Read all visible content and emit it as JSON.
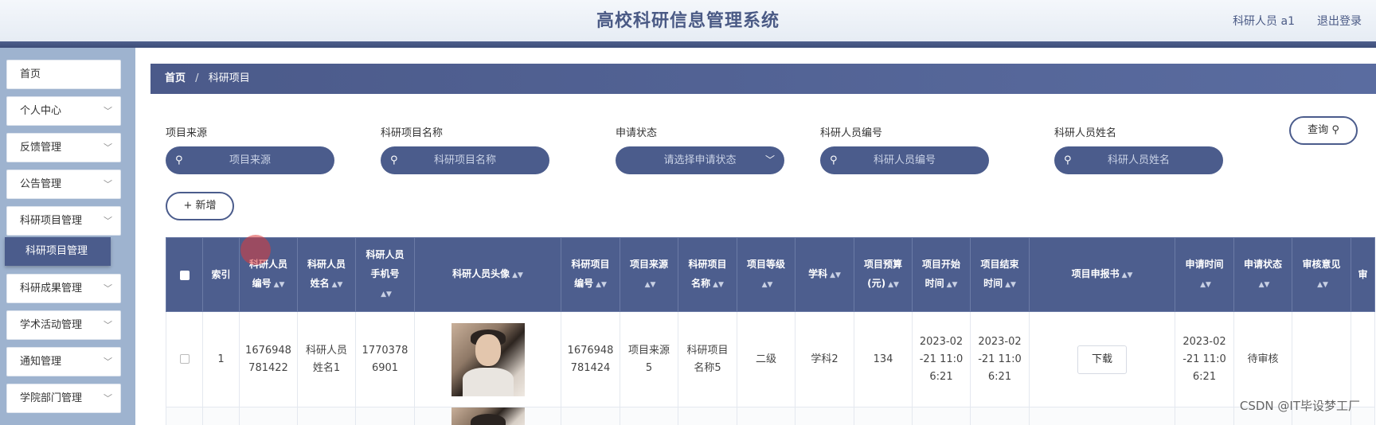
{
  "header": {
    "title": "高校科研信息管理系统",
    "user": "科研人员 a1",
    "logout": "退出登录"
  },
  "sidebar": {
    "items": [
      {
        "label": "首页",
        "has_chevron": false
      },
      {
        "label": "个人中心",
        "has_chevron": true
      },
      {
        "label": "反馈管理",
        "has_chevron": true
      },
      {
        "label": "公告管理",
        "has_chevron": true
      },
      {
        "label": "科研项目管理",
        "has_chevron": true
      },
      {
        "label": "科研成果管理",
        "has_chevron": true
      },
      {
        "label": "学术活动管理",
        "has_chevron": true
      },
      {
        "label": "通知管理",
        "has_chevron": true
      },
      {
        "label": "学院部门管理",
        "has_chevron": true
      }
    ],
    "active_sub": "科研项目管理",
    "chevron_glyph": "﹀"
  },
  "breadcrumb": {
    "home": "首页",
    "sep": "/",
    "current": "科研项目"
  },
  "filters": [
    {
      "label": "项目来源",
      "placeholder": "项目来源",
      "type": "text"
    },
    {
      "label": "科研项目名称",
      "placeholder": "科研项目名称",
      "type": "text"
    },
    {
      "label": "申请状态",
      "placeholder": "请选择申请状态",
      "type": "select"
    },
    {
      "label": "科研人员编号",
      "placeholder": "科研人员编号",
      "type": "text"
    },
    {
      "label": "科研人员姓名",
      "placeholder": "科研人员姓名",
      "type": "text"
    }
  ],
  "buttons": {
    "query": "查询",
    "add": "新增"
  },
  "table": {
    "columns": [
      {
        "l1": "",
        "l2": "",
        "sortable": false
      },
      {
        "l1": "索引",
        "l2": "",
        "sortable": false
      },
      {
        "l1": "科研人员",
        "l2": "编号",
        "sortable": true
      },
      {
        "l1": "科研人员",
        "l2": "姓名",
        "sortable": true
      },
      {
        "l1": "科研人员",
        "l2": "手机号",
        "sortable": true
      },
      {
        "l1": "科研人员头像",
        "l2": "",
        "sortable": true
      },
      {
        "l1": "科研项目",
        "l2": "编号",
        "sortable": true
      },
      {
        "l1": "项目来源",
        "l2": "",
        "sortable": true
      },
      {
        "l1": "科研项目",
        "l2": "名称",
        "sortable": true
      },
      {
        "l1": "项目等级",
        "l2": "",
        "sortable": true
      },
      {
        "l1": "学科",
        "l2": "",
        "sortable": true
      },
      {
        "l1": "项目预算",
        "l2": "(元)",
        "sortable": true
      },
      {
        "l1": "项目开始",
        "l2": "时间",
        "sortable": true
      },
      {
        "l1": "项目结束",
        "l2": "时间",
        "sortable": true
      },
      {
        "l1": "项目申报书",
        "l2": "",
        "sortable": true
      },
      {
        "l1": "申请时间",
        "l2": "",
        "sortable": true
      },
      {
        "l1": "申请状态",
        "l2": "",
        "sortable": true
      },
      {
        "l1": "审核意见",
        "l2": "",
        "sortable": true
      },
      {
        "l1": "审",
        "l2": "",
        "sortable": false
      }
    ],
    "rows": [
      {
        "index": "1",
        "researcher_no": [
          "1676948",
          "781422"
        ],
        "researcher_name": [
          "科研人员",
          "姓名1"
        ],
        "phone": [
          "1770378",
          "6901"
        ],
        "project_no": [
          "1676948",
          "781424"
        ],
        "source": [
          "项目来源",
          "5"
        ],
        "project_name": [
          "科研项目",
          "名称5"
        ],
        "level": "二级",
        "subject": "学科2",
        "budget": "134",
        "start_time": [
          "2023-02",
          "-21 11:0",
          "6:21"
        ],
        "end_time": [
          "2023-02",
          "-21 11:0",
          "6:21"
        ],
        "download": "下载",
        "apply_time": [
          "2023-02",
          "-21 11:0",
          "6:21"
        ],
        "status": "待审核",
        "review": ""
      }
    ]
  },
  "watermark": "CSDN @IT毕设梦工厂"
}
